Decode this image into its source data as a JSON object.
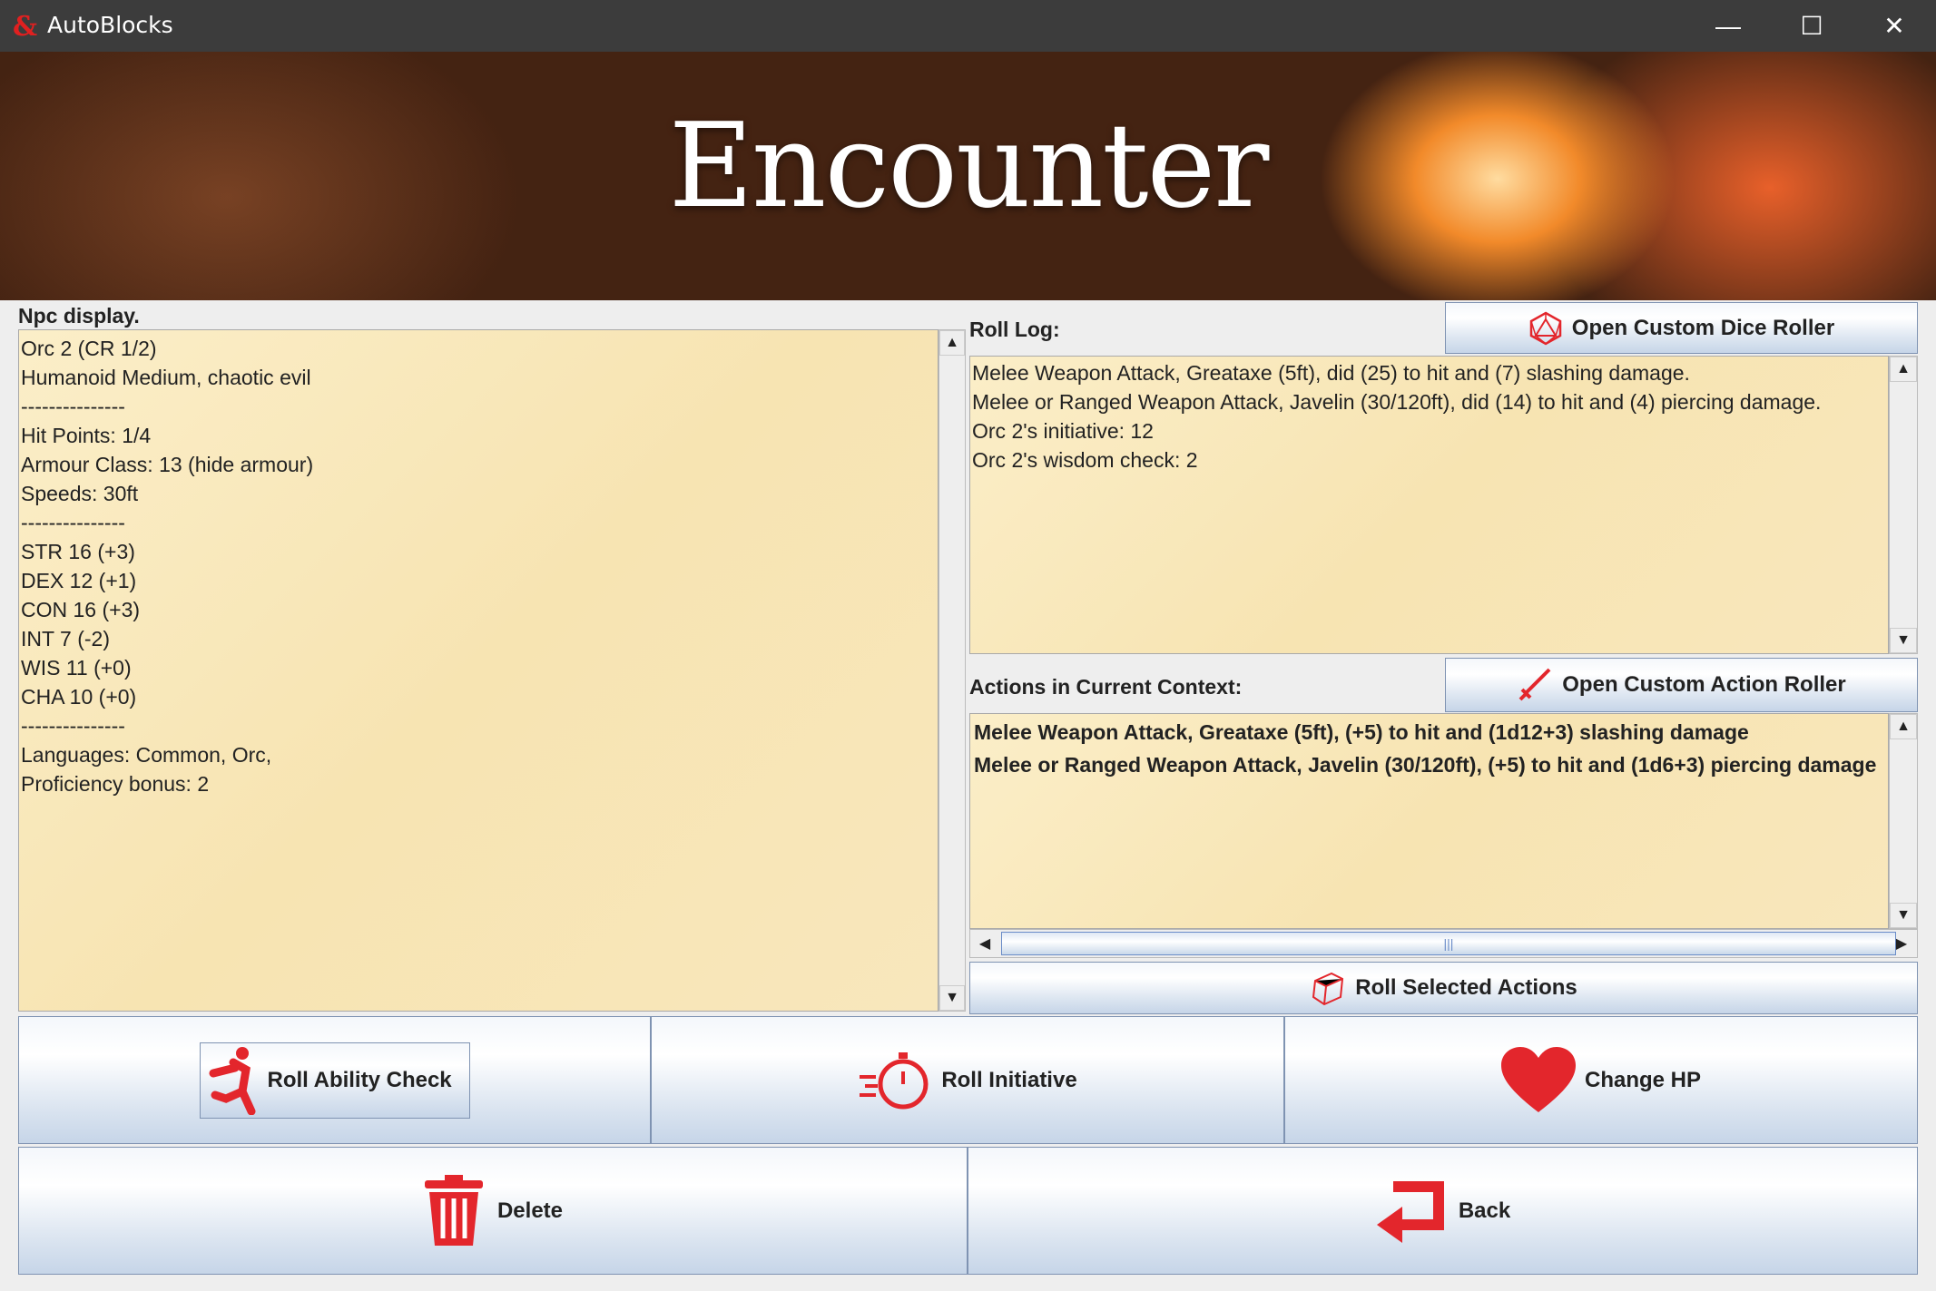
{
  "window": {
    "title": "AutoBlocks",
    "logo": "&",
    "minimize": "—",
    "maximize": "☐",
    "close": "✕"
  },
  "banner": {
    "title": "Encounter"
  },
  "npc": {
    "label": "Npc display.",
    "lines": [
      "Orc 2 (CR 1/2)",
      "Humanoid Medium, chaotic evil",
      "---------------",
      "Hit Points: 1/4",
      "Armour Class: 13 (hide armour)",
      "Speeds: 30ft",
      "---------------",
      "STR 16 (+3)",
      "DEX 12 (+1)",
      "CON 16 (+3)",
      "INT 7 (-2)",
      "WIS 11 (+0)",
      "CHA 10 (+0)",
      "---------------",
      "Languages: Common, Orc,",
      "Proficiency bonus: 2"
    ]
  },
  "roll_log": {
    "label": "Roll Log:",
    "button": "Open Custom Dice Roller",
    "entries": [
      "Melee Weapon Attack, Greataxe (5ft), did (25) to hit and (7) slashing damage.",
      "Melee or Ranged Weapon Attack, Javelin (30/120ft), did (14) to hit and (4) piercing damage.",
      "Orc 2's initiative: 12",
      "Orc 2's wisdom check: 2"
    ]
  },
  "actions": {
    "label": "Actions in Current Context:",
    "button": "Open Custom Action Roller",
    "items": [
      "Melee Weapon Attack, Greataxe (5ft), (+5) to hit and (1d12+3) slashing damage",
      "Melee or Ranged Weapon Attack, Javelin (30/120ft), (+5) to hit and (1d6+3) piercing damage"
    ],
    "roll_selected": "Roll Selected Actions"
  },
  "buttons": {
    "ability": "Roll Ability Check",
    "initiative": "Roll Initiative",
    "hp": "Change HP",
    "delete": "Delete",
    "back": "Back"
  },
  "colors": {
    "accent": "#e3262c",
    "parchment": "#f8e7bc",
    "titlebar": "#3c3c3c"
  }
}
